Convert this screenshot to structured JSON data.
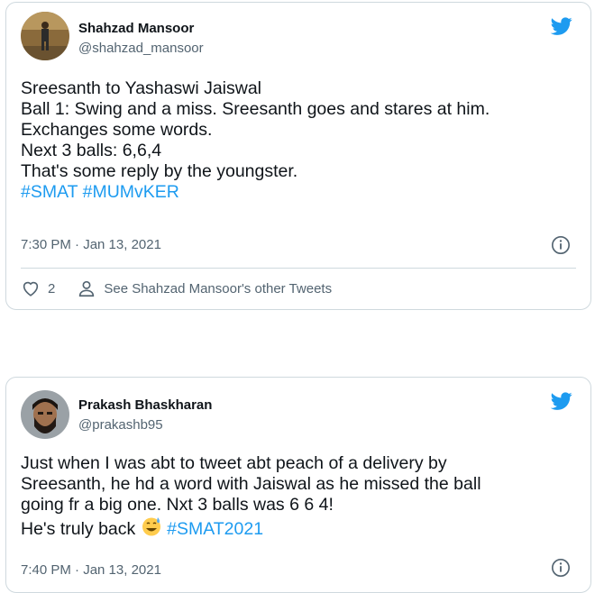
{
  "tweets": [
    {
      "name": "Shahzad Mansoor",
      "handle": "@shahzad_mansoor",
      "lines": [
        "Sreesanth to Yashaswi Jaiswal",
        "Ball 1: Swing and a miss. Sreesanth goes and stares at him.",
        "Exchanges some words.",
        "Next 3 balls: 6,6,4",
        "That's some reply by the youngster."
      ],
      "hashtags": "#SMAT #MUMvKER",
      "timestamp": "7:30 PM · Jan 13, 2021",
      "likes": "2",
      "other_tweets": "See Shahzad Mansoor's other Tweets"
    },
    {
      "name": "Prakash Bhaskharan",
      "handle": "@prakashb95",
      "lines": [
        "Just when I was abt to tweet abt peach of a delivery by",
        "Sreesanth, he hd a word with Jaiswal as he missed the ball",
        "going fr a big one. Nxt 3 balls was 6 6 4!"
      ],
      "last_line_text": "He's truly back",
      "hashtag": "#SMAT2021",
      "timestamp": "7:40 PM · Jan 13, 2021"
    }
  ],
  "icons": {
    "brand": "twitter-bird-icon",
    "info": "info-icon",
    "like": "heart-icon",
    "profile": "person-icon",
    "emoji": "grinning-sweat-emoji"
  },
  "colors": {
    "accent": "#1d9bf0",
    "text": "#0f1419",
    "muted": "#536471",
    "border": "#cfd9de"
  }
}
